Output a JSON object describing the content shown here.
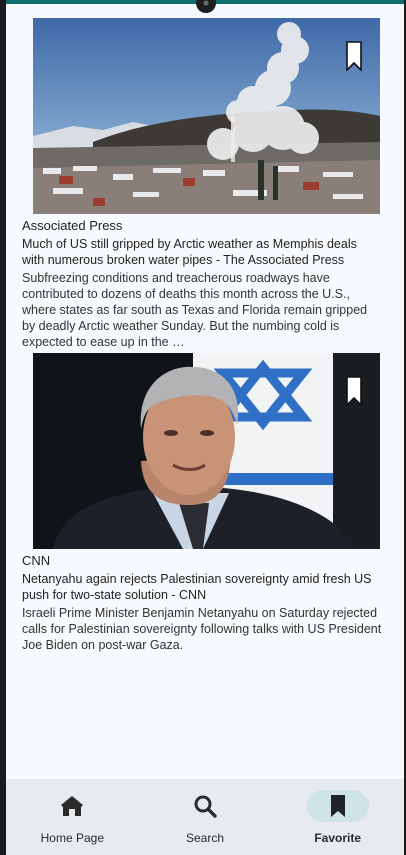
{
  "articles": [
    {
      "source": "Associated Press",
      "headline": "Much of US still gripped by Arctic weather as Memphis deals with numerous broken water pipes - The Associated Press",
      "description": "Subfreezing conditions and treacherous roadways have contributed to dozens of deaths this month across the U.S., where states as far south as Texas and Florida remain gripped by deadly Arctic weather Sunday. But the numbing cold is expected to ease up in the …",
      "image_icon": "winter-town-photo"
    },
    {
      "source": "CNN",
      "headline": "Netanyahu again rejects Palestinian sovereignty amid fresh US push for two-state solution - CNN",
      "description": "Israeli Prime Minister Benjamin Netanyahu on Saturday rejected calls for Palestinian sovereignty following talks with US President Joe Biden on post-war Gaza.",
      "image_icon": "portrait-photo"
    }
  ],
  "nav": {
    "items": [
      {
        "label": "Home Page",
        "icon": "home-icon",
        "active": false
      },
      {
        "label": "Search",
        "icon": "search-icon",
        "active": false
      },
      {
        "label": "Favorite",
        "icon": "bookmark-icon",
        "active": true
      }
    ]
  },
  "colors": {
    "accent": "#0f6e6e",
    "nav_background": "#e7ebef",
    "active_pill": "#cfe3e9"
  }
}
